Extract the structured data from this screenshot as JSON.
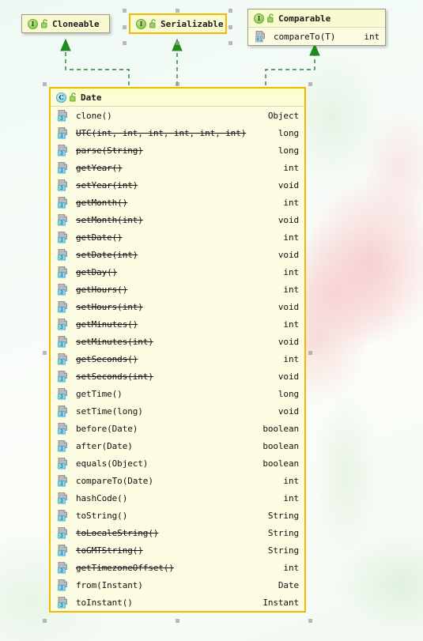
{
  "diagram": {
    "title": "UML class diagram",
    "colors": {
      "node_fill": "#fcfce2",
      "node_header_fill": "#fafad0",
      "selected_border": "#f3b800",
      "unselected_border": "#9a9a8e",
      "relation_line": "#2f7d32",
      "interface_icon": "#8ccc55",
      "class_icon": "#6ec6e3",
      "handle": "#9e9e9e"
    },
    "relations": [
      {
        "name": "date-implements-cloneable",
        "from": "Date",
        "to": "Cloneable",
        "kind": "realization"
      },
      {
        "name": "date-implements-serializable",
        "from": "Date",
        "to": "Serializable",
        "kind": "realization"
      },
      {
        "name": "date-implements-comparable",
        "from": "Date",
        "to": "Comparable",
        "kind": "realization"
      }
    ]
  },
  "nodes": {
    "cloneable": {
      "name": "Cloneable",
      "stereotype_icon": "interface-icon",
      "visibility_icon": "public-unlocked-icon",
      "selected": false,
      "members": []
    },
    "serializable": {
      "name": "Serializable",
      "stereotype_icon": "interface-icon",
      "visibility_icon": "public-unlocked-icon",
      "selected": true,
      "members": []
    },
    "comparable": {
      "name": "Comparable",
      "stereotype_icon": "interface-icon",
      "visibility_icon": "public-unlocked-icon",
      "selected": false,
      "members": [
        {
          "icon": "method-01-icon",
          "name": "compareTo(T)",
          "type": "int",
          "deprecated": false
        }
      ]
    },
    "date": {
      "name": "Date",
      "stereotype_icon": "class-icon",
      "visibility_icon": "public-unlocked-icon",
      "selected": true,
      "members": [
        {
          "icon": "method-j-icon",
          "name": "clone()",
          "type": "Object",
          "deprecated": false
        },
        {
          "icon": "method-j-icon",
          "name": "UTC(int, int, int, int, int, int)",
          "type": "long",
          "deprecated": true
        },
        {
          "icon": "method-j-icon",
          "name": "parse(String)",
          "type": "long",
          "deprecated": true
        },
        {
          "icon": "method-j-icon",
          "name": "getYear()",
          "type": "int",
          "deprecated": true
        },
        {
          "icon": "method-j-icon",
          "name": "setYear(int)",
          "type": "void",
          "deprecated": true
        },
        {
          "icon": "method-j-icon",
          "name": "getMonth()",
          "type": "int",
          "deprecated": true
        },
        {
          "icon": "method-j-icon",
          "name": "setMonth(int)",
          "type": "void",
          "deprecated": true
        },
        {
          "icon": "method-j-icon",
          "name": "getDate()",
          "type": "int",
          "deprecated": true
        },
        {
          "icon": "method-j-icon",
          "name": "setDate(int)",
          "type": "void",
          "deprecated": true
        },
        {
          "icon": "method-j-icon",
          "name": "getDay()",
          "type": "int",
          "deprecated": true
        },
        {
          "icon": "method-j-icon",
          "name": "getHours()",
          "type": "int",
          "deprecated": true
        },
        {
          "icon": "method-j-icon",
          "name": "setHours(int)",
          "type": "void",
          "deprecated": true
        },
        {
          "icon": "method-j-icon",
          "name": "getMinutes()",
          "type": "int",
          "deprecated": true
        },
        {
          "icon": "method-j-icon",
          "name": "setMinutes(int)",
          "type": "void",
          "deprecated": true
        },
        {
          "icon": "method-j-icon",
          "name": "getSeconds()",
          "type": "int",
          "deprecated": true
        },
        {
          "icon": "method-j-icon",
          "name": "setSeconds(int)",
          "type": "void",
          "deprecated": true
        },
        {
          "icon": "method-j-icon",
          "name": "getTime()",
          "type": "long",
          "deprecated": false
        },
        {
          "icon": "method-j-icon",
          "name": "setTime(long)",
          "type": "void",
          "deprecated": false
        },
        {
          "icon": "method-j-icon",
          "name": "before(Date)",
          "type": "boolean",
          "deprecated": false
        },
        {
          "icon": "method-j-icon",
          "name": "after(Date)",
          "type": "boolean",
          "deprecated": false
        },
        {
          "icon": "method-j-icon",
          "name": "equals(Object)",
          "type": "boolean",
          "deprecated": false
        },
        {
          "icon": "method-j-icon",
          "name": "compareTo(Date)",
          "type": "int",
          "deprecated": false
        },
        {
          "icon": "method-j-icon",
          "name": "hashCode()",
          "type": "int",
          "deprecated": false
        },
        {
          "icon": "method-j-icon",
          "name": "toString()",
          "type": "String",
          "deprecated": false
        },
        {
          "icon": "method-j-icon",
          "name": "toLocaleString()",
          "type": "String",
          "deprecated": true
        },
        {
          "icon": "method-j-icon",
          "name": "toGMTString()",
          "type": "String",
          "deprecated": true
        },
        {
          "icon": "method-j-icon",
          "name": "getTimezoneOffset()",
          "type": "int",
          "deprecated": true
        },
        {
          "icon": "method-j-icon",
          "name": "from(Instant)",
          "type": "Date",
          "deprecated": false
        },
        {
          "icon": "method-j-icon",
          "name": "toInstant()",
          "type": "Instant",
          "deprecated": false
        }
      ]
    }
  }
}
